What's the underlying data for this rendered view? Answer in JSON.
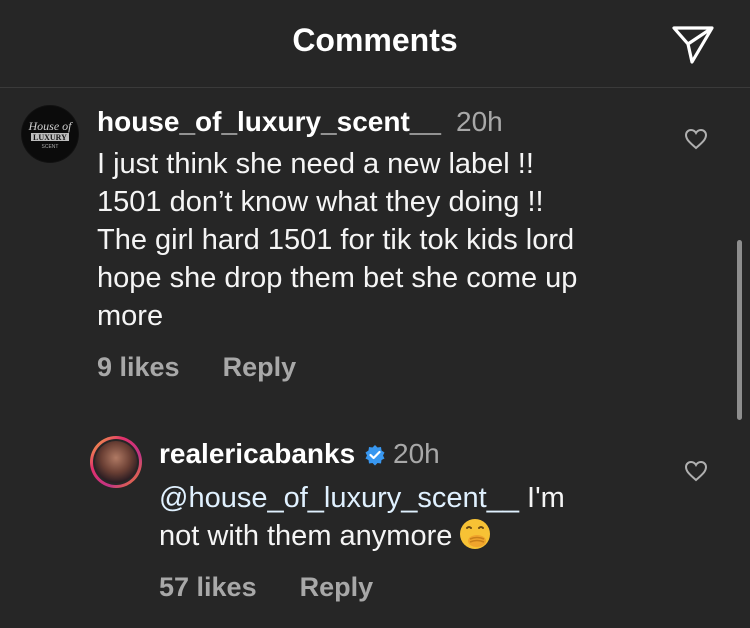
{
  "header": {
    "title": "Comments",
    "share_icon": "paper-plane-icon"
  },
  "comments": [
    {
      "username": "house_of_luxury_scent__",
      "time": "20h",
      "avatar_text": "Luxury",
      "lines": [
        "I just think she need a new  label !!",
        "1501 don’t know what they doing !!",
        "The girl hard  1501 for tik tok kids lord",
        "hope she drop them bet she come up",
        "more"
      ],
      "likes": "9 likes",
      "reply": "Reply"
    },
    {
      "username": "realericabanks",
      "verified": true,
      "time": "20h",
      "mention": "@house_of_luxury_scent__",
      "line1_rest": " I'm",
      "line2": "not with them anymore",
      "emoji": "hand-over-mouth-emoji",
      "likes": "57 likes",
      "reply": "Reply"
    }
  ],
  "colors": {
    "background": "#262626",
    "secondary_text": "#a8a8a8",
    "verified_blue": "#3897f0"
  }
}
